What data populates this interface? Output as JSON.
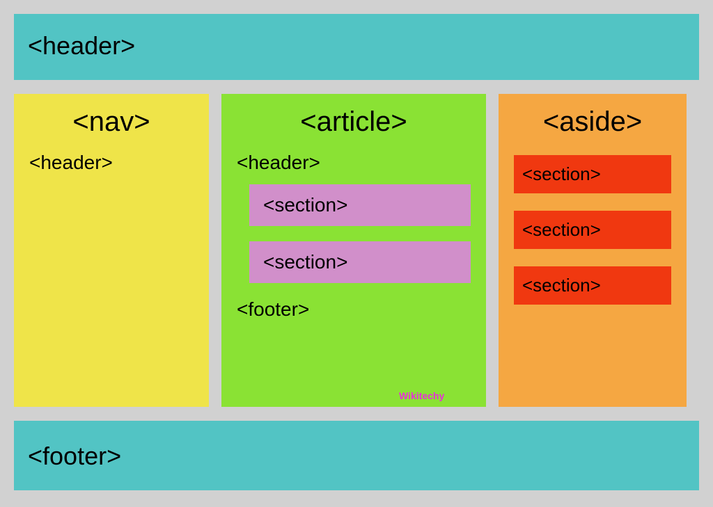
{
  "header": {
    "label": "<header>"
  },
  "nav": {
    "title": "<nav>",
    "header_label": "<header>"
  },
  "article": {
    "title": "<article>",
    "header_label": "<header>",
    "sections": [
      "<section>",
      "<section>"
    ],
    "footer_label": "<footer>",
    "watermark": "Wikitechy"
  },
  "aside": {
    "title": "<aside>",
    "sections": [
      "<section>",
      "<section>",
      "<section>"
    ]
  },
  "footer": {
    "label": "<footer>"
  },
  "colors": {
    "background": "#d1d1d1",
    "header_footer": "#52c4c4",
    "nav": "#efe449",
    "article": "#8ae234",
    "article_section": "#d18fca",
    "aside": "#f5a742",
    "aside_section": "#f03810",
    "watermark": "#e830d8"
  }
}
